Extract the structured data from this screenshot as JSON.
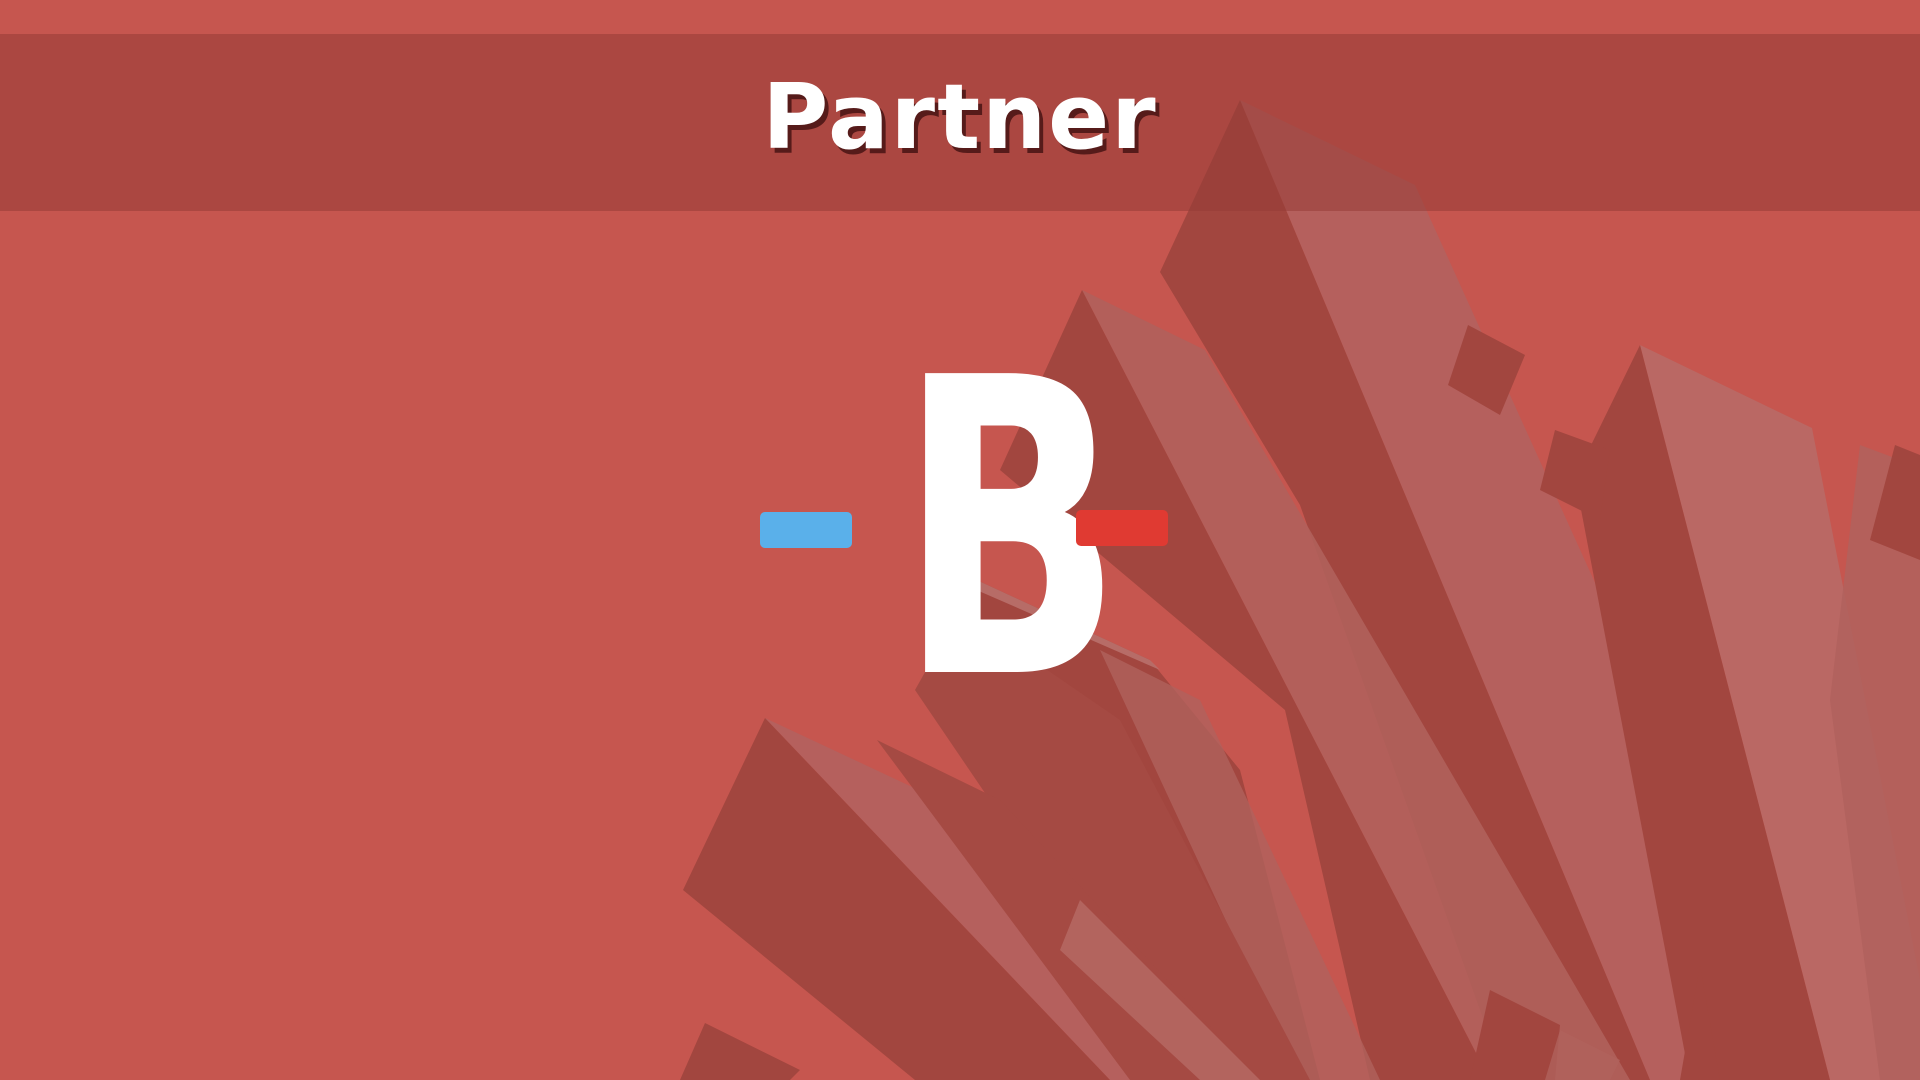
{
  "header": {
    "title": "Partner"
  },
  "logo": {
    "letter": "B",
    "left_bar_color": "#5ab0ea",
    "right_bar_color": "#e03a32"
  },
  "colors": {
    "background": "#c6564f",
    "header_band": "#ae4c46",
    "shard_dark": "#a2463f",
    "shard_light": "#b86a66"
  }
}
